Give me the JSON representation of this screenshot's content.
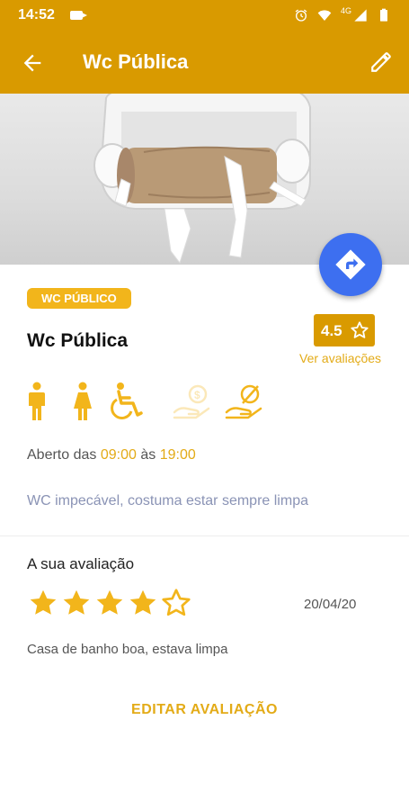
{
  "status_bar": {
    "time": "14:52",
    "network": "4G"
  },
  "app_bar": {
    "title": "Wc Pública"
  },
  "place": {
    "category": "WC PÚBLICO",
    "name": "Wc Pública",
    "rating": "4.5",
    "see_ratings": "Ver avaliações",
    "amenities": [
      "male-icon",
      "female-icon",
      "wheelchair-icon",
      "paid-coin-icon",
      "free-hand-icon"
    ],
    "hours_prefix": "Aberto das",
    "open_time": "09:00",
    "hours_mid": "às",
    "close_time": "19:00",
    "description": "WC impecável, costuma estar sempre limpa"
  },
  "your_review": {
    "title": "A sua avaliação",
    "stars": 4,
    "max_stars": 5,
    "date": "20/04/20",
    "text": "Casa de banho boa, estava limpa",
    "edit_label": "EDITAR AVALIAÇÃO"
  },
  "colors": {
    "primary": "#d99a00",
    "accent": "#f2b51b",
    "fab": "#3d6ff0"
  }
}
